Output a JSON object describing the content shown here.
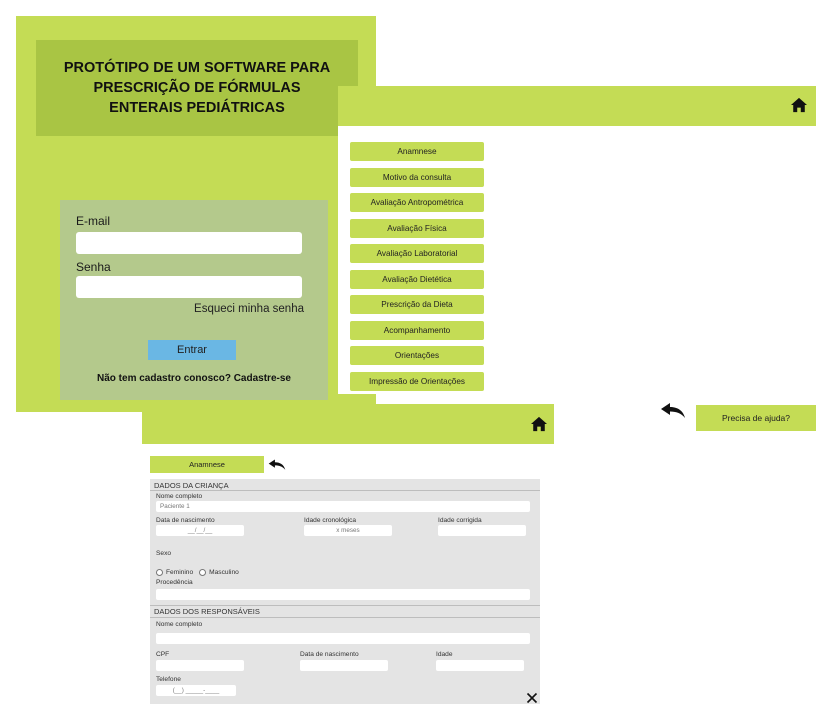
{
  "colors": {
    "accent_green": "#c4dc55",
    "title_green": "#a9c544",
    "login_card": "#b4c98c",
    "login_button": "#6ab7e4",
    "form_panel": "#e4e4e4"
  },
  "login": {
    "title": "PROTÓTIPO DE UM SOFTWARE PARA\nPRESCRIÇÃO DE FÓRMULAS\nENTERAIS PEDIÁTRICAS",
    "email_label": "E-mail",
    "password_label": "Senha",
    "forgot_password": "Esqueci minha senha",
    "submit": "Entrar",
    "signup": "Não tem cadastro conosco? Cadastre-se"
  },
  "menu": {
    "home_icon": "home-icon",
    "items": [
      "Anamnese",
      "Motivo da consulta",
      "Avaliação Antropométrica",
      "Avaliação Física",
      "Avaliação Laboratorial",
      "Avaliação Dietética",
      "Prescrição da Dieta",
      "Acompanhamento",
      "Orientações",
      "Impressão de Orientações"
    ],
    "back_icon": "back-arrow-icon",
    "help": "Precisa de ajuda?"
  },
  "form": {
    "home_icon": "home-icon",
    "tab": "Anamnese",
    "back_icon": "back-arrow-icon",
    "child_section": {
      "title": "DADOS DA CRIANÇA",
      "name_label": "Nome completo",
      "name_value": "Paciente 1",
      "birth_label": "Data de nascimento",
      "birth_placeholder": "__/__/__",
      "chrono_age_label": "Idade cronológica",
      "chrono_age_placeholder": "x meses",
      "corrected_age_label": "Idade corrigida",
      "sex_label": "Sexo",
      "sex_options": [
        "Feminino",
        "Masculino"
      ],
      "origin_label": "Procedência"
    },
    "guardian_section": {
      "title": "DADOS DOS RESPONSÁVEIS",
      "name_label": "Nome completo",
      "cpf_label": "CPF",
      "birth_label": "Data de nascimento",
      "age_label": "Idade",
      "phone_label": "Telefone",
      "phone_placeholder": "(__) _____-____"
    },
    "close_icon": "close-icon"
  }
}
